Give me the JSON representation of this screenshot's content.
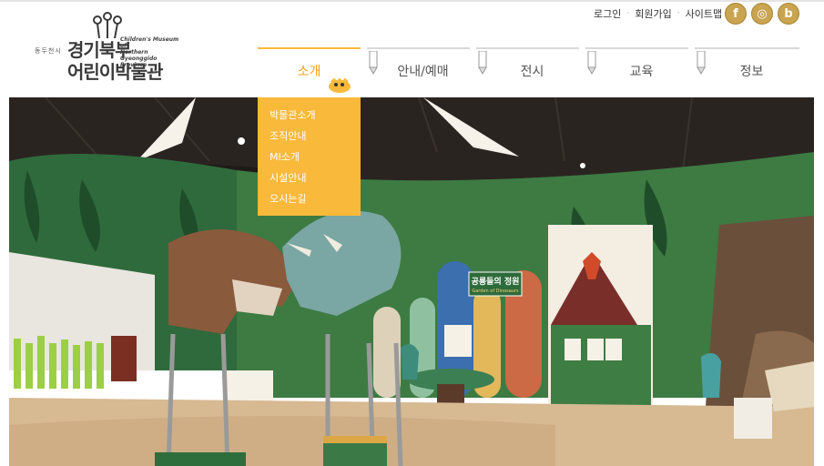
{
  "logo": {
    "line1": "동두천시",
    "line2": "경기북부",
    "line3": "어린이박물관",
    "en": "Children's Museum of\nNorthern Gyeonggido\nProvince"
  },
  "util": {
    "login": "로그인",
    "join": "회원가입",
    "sitemap": "사이트맵"
  },
  "social": [
    {
      "name": "facebook",
      "glyph": "f"
    },
    {
      "name": "instagram",
      "glyph": "◎"
    },
    {
      "name": "blog",
      "glyph": "b"
    }
  ],
  "gnb": {
    "items": [
      {
        "label": "소개"
      },
      {
        "label": "안내/예매"
      },
      {
        "label": "전시"
      },
      {
        "label": "교육"
      },
      {
        "label": "정보"
      }
    ],
    "submenu": [
      "박물관소개",
      "조직안내",
      "MI소개",
      "시설안내",
      "오시는길"
    ]
  },
  "hero": {
    "sign": "공룡들의 정원",
    "sign_sub": "Garden of Dinosaurs"
  },
  "colors": {
    "accent": "#f9b93b",
    "social": "#c9a451"
  }
}
